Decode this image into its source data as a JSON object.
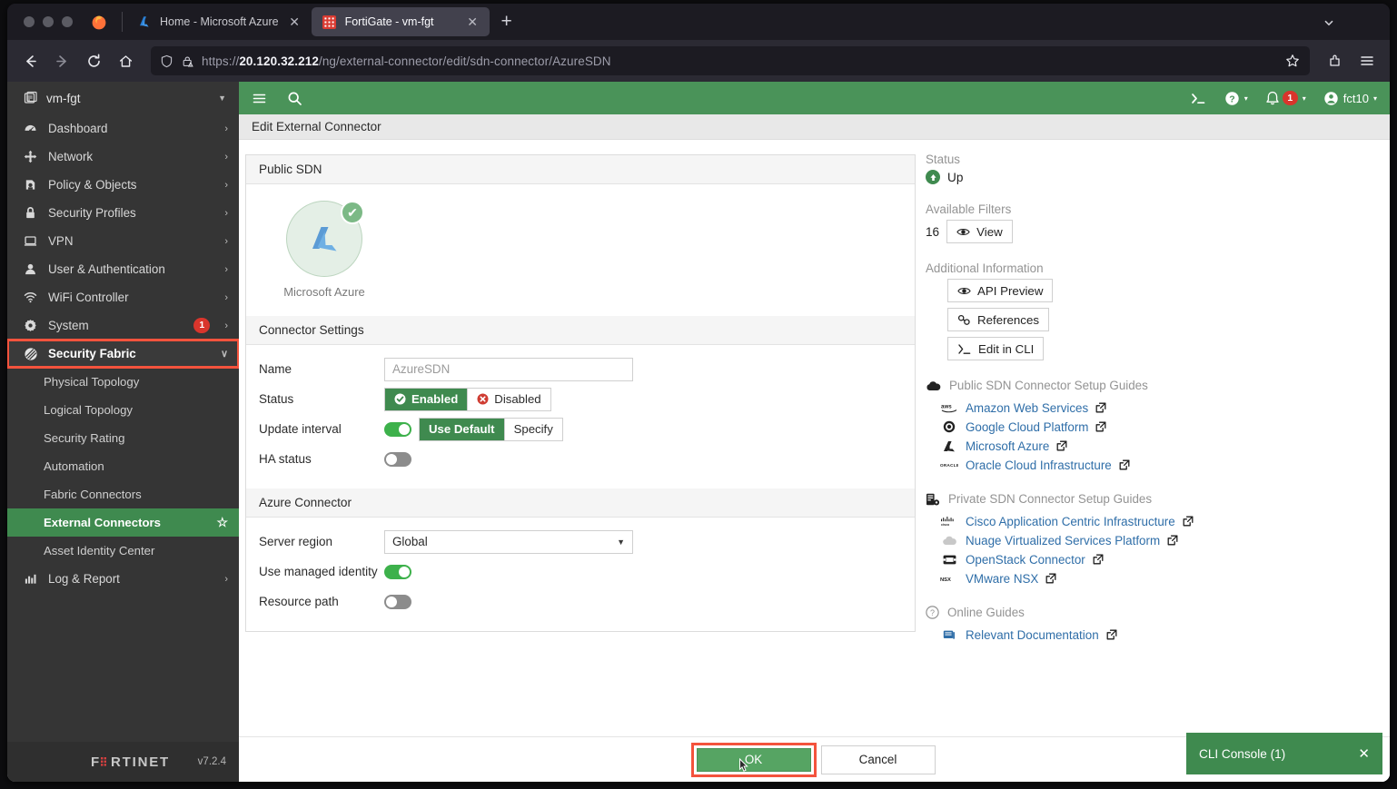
{
  "browser": {
    "tabs": [
      {
        "title": "Home - Microsoft Azure",
        "favicon": "azure-icon",
        "active": false,
        "close_label": "✕"
      },
      {
        "title": "FortiGate - vm-fgt",
        "favicon": "fortigate-icon",
        "active": true,
        "close_label": "✕"
      }
    ],
    "new_tab_label": "+",
    "url_prefix": "https://",
    "url_host": "20.120.32.212",
    "url_path": "/ng/external-connector/edit/sdn-connector/AzureSDN",
    "nav": {
      "back": "←",
      "forward": "→",
      "reload": "↻",
      "home": "⌂"
    }
  },
  "sidebar": {
    "vdom": "vm-fgt",
    "items": [
      {
        "label": "Dashboard",
        "icon": "dashboard-icon",
        "chevron": "›",
        "badge": ""
      },
      {
        "label": "Network",
        "icon": "network-icon",
        "chevron": "›",
        "badge": ""
      },
      {
        "label": "Policy & Objects",
        "icon": "policy-icon",
        "chevron": "›",
        "badge": ""
      },
      {
        "label": "Security Profiles",
        "icon": "lock-icon",
        "chevron": "›",
        "badge": ""
      },
      {
        "label": "VPN",
        "icon": "vpn-icon",
        "chevron": "›",
        "badge": ""
      },
      {
        "label": "User & Authentication",
        "icon": "user-icon",
        "chevron": "›",
        "badge": ""
      },
      {
        "label": "WiFi Controller",
        "icon": "wifi-icon",
        "chevron": "›",
        "badge": ""
      },
      {
        "label": "System",
        "icon": "gear-icon",
        "chevron": "›",
        "badge": "1"
      },
      {
        "label": "Security Fabric",
        "icon": "fabric-icon",
        "chevron": "∨",
        "badge": ""
      }
    ],
    "subitems": [
      {
        "label": "Physical Topology",
        "active": false
      },
      {
        "label": "Logical Topology",
        "active": false
      },
      {
        "label": "Security Rating",
        "active": false
      },
      {
        "label": "Automation",
        "active": false
      },
      {
        "label": "Fabric Connectors",
        "active": false
      },
      {
        "label": "External Connectors",
        "active": true,
        "star": "☆"
      },
      {
        "label": "Asset Identity Center",
        "active": false
      }
    ],
    "log_report": {
      "label": "Log & Report",
      "icon": "chart-icon",
      "chevron": "›"
    },
    "brand": "FORTINET",
    "version": "v7.2.4"
  },
  "topbar": {
    "menu_icon": "hamburger-icon",
    "search_icon": "search-icon",
    "cli_icon": "cli-icon",
    "help_label": "",
    "alert_count": "1",
    "user": "fct10",
    "caret": "▾"
  },
  "page": {
    "title": "Edit External Connector"
  },
  "form": {
    "public_sdn": {
      "heading": "Public SDN",
      "selected_tile": "Microsoft Azure",
      "check_glyph": "✔"
    },
    "connector_settings": {
      "heading": "Connector Settings",
      "name_label": "Name",
      "name_value": "AzureSDN",
      "status_label": "Status",
      "status_enabled": "Enabled",
      "status_disabled": "Disabled",
      "status_selected": "Enabled",
      "update_interval_label": "Update interval",
      "update_interval_toggle": "on",
      "update_use_default": "Use Default",
      "update_specify": "Specify",
      "update_selected": "Use Default",
      "ha_status_label": "HA status",
      "ha_status_toggle": "off"
    },
    "azure_connector": {
      "heading": "Azure Connector",
      "server_region_label": "Server region",
      "server_region_value": "Global",
      "use_managed_identity_label": "Use managed identity",
      "use_managed_identity_toggle": "on",
      "resource_path_label": "Resource path",
      "resource_path_toggle": "off"
    }
  },
  "info": {
    "status_heading": "Status",
    "status_value": "Up",
    "status_icon": "arrow-up-icon",
    "filters_heading": "Available Filters",
    "filters_count": "16",
    "filters_view_label": "View",
    "additional_heading": "Additional Information",
    "buttons": [
      {
        "label": "API Preview",
        "icon": "eye-icon"
      },
      {
        "label": "References",
        "icon": "link-icon"
      },
      {
        "label": "Edit in CLI",
        "icon": "cli-icon"
      }
    ],
    "public_guides_heading": "Public SDN Connector Setup Guides",
    "public_guides": [
      {
        "label": "Amazon Web Services",
        "icon": "aws-icon"
      },
      {
        "label": "Google Cloud Platform",
        "icon": "gcp-icon"
      },
      {
        "label": "Microsoft Azure",
        "icon": "azure-icon"
      },
      {
        "label": "Oracle Cloud Infrastructure",
        "icon": "oracle-icon"
      }
    ],
    "private_guides_heading": "Private SDN Connector Setup Guides",
    "private_guides": [
      {
        "label": "Cisco Application Centric Infrastructure",
        "icon": "cisco-icon"
      },
      {
        "label": "Nuage Virtualized Services Platform",
        "icon": "nuage-icon"
      },
      {
        "label": "OpenStack Connector",
        "icon": "openstack-icon"
      },
      {
        "label": "VMware NSX",
        "icon": "nsx-icon"
      }
    ],
    "online_guides_heading": "Online Guides",
    "online_guides": [
      {
        "label": "Relevant Documentation",
        "icon": "document-icon"
      }
    ],
    "external_link_glyph": "↗"
  },
  "footer": {
    "ok_label": "OK",
    "cancel_label": "Cancel"
  },
  "cli_console": {
    "label": "CLI Console (1)",
    "close": "✕"
  },
  "colors": {
    "fortinet_green": "#4a9359",
    "accent_green": "#3f8a4f",
    "alert_red": "#d9352c",
    "highlight_red": "#f4533d",
    "link_blue": "#2f6ea8"
  }
}
